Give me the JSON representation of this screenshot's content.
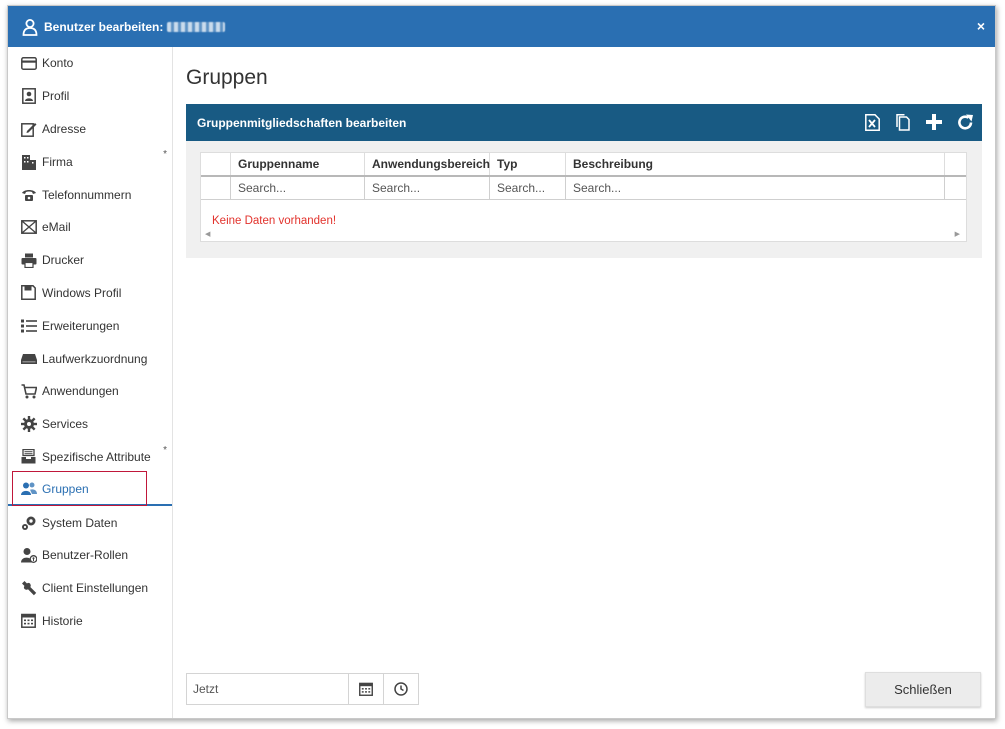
{
  "window": {
    "title": "Benutzer bearbeiten:",
    "close_label": "×"
  },
  "sidebar": {
    "items": [
      {
        "label": "Konto",
        "icon": "card-icon",
        "star": ""
      },
      {
        "label": "Profil",
        "icon": "profile-icon",
        "star": ""
      },
      {
        "label": "Adresse",
        "icon": "edit-icon",
        "star": ""
      },
      {
        "label": "Firma",
        "icon": "building-icon",
        "star": "*"
      },
      {
        "label": "Telefonnummern",
        "icon": "phone-icon",
        "star": ""
      },
      {
        "label": "eMail",
        "icon": "mail-icon",
        "star": ""
      },
      {
        "label": "Drucker",
        "icon": "printer-icon",
        "star": ""
      },
      {
        "label": "Windows Profil",
        "icon": "floppy-icon",
        "star": ""
      },
      {
        "label": "Erweiterungen",
        "icon": "list-icon",
        "star": ""
      },
      {
        "label": "Laufwerkzuordnung",
        "icon": "drive-icon",
        "star": ""
      },
      {
        "label": "Anwendungen",
        "icon": "cart-icon",
        "star": ""
      },
      {
        "label": "Services",
        "icon": "gear-icon",
        "star": ""
      },
      {
        "label": "Spezifische Attribute",
        "icon": "inbox-icon",
        "star": "*"
      },
      {
        "label": "Gruppen",
        "icon": "users-icon",
        "star": ""
      },
      {
        "label": "System Daten",
        "icon": "gears-icon",
        "star": ""
      },
      {
        "label": "Benutzer-Rollen",
        "icon": "user-role-icon",
        "star": ""
      },
      {
        "label": "Client Einstellungen",
        "icon": "wrench-icon",
        "star": ""
      },
      {
        "label": "Historie",
        "icon": "calendar-icon",
        "star": ""
      }
    ],
    "active": "Gruppen"
  },
  "main": {
    "page_title": "Gruppen",
    "panel": {
      "title": "Gruppenmitgliedschaften bearbeiten",
      "tools": [
        "excel-export-icon",
        "copy-icon",
        "plus-icon",
        "refresh-icon"
      ]
    },
    "grid": {
      "columns": [
        "Gruppenname",
        "Anwendungsbereich",
        "Typ",
        "Beschreibung"
      ],
      "filter_placeholder": "Search...",
      "empty_text": "Keine Daten vorhanden!"
    },
    "date_field": {
      "value": "Jetzt"
    },
    "close_button": "Schließen"
  },
  "colors": {
    "titlebar": "#2a6fb2",
    "panel_header": "#185a83",
    "accent": "#2a6fb2",
    "error": "#e2322c",
    "highlight_border": "#c0173a"
  }
}
